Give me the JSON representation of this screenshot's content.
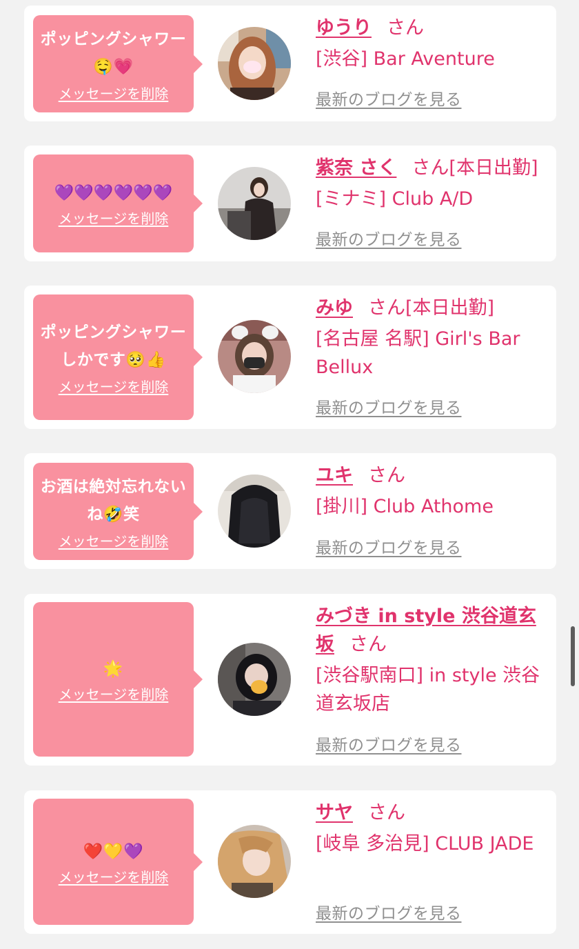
{
  "colors": {
    "background": "#f2f2f2",
    "bubble": "#f9919f",
    "accent": "#e0336c",
    "link_gray": "#8f8f8f"
  },
  "messages": [
    {
      "text": "ポッピングシャワー🤤💗",
      "delete_label": "メッセージを削除",
      "avatar_icon": "profile-photo-woman-1",
      "name": "ゆうり",
      "honorific": "さん",
      "status": "",
      "shop": "[渋谷] Bar Aventure",
      "blog_label": "最新のブログを見る"
    },
    {
      "text": "💜💜💜💜💜💜",
      "delete_label": "メッセージを削除",
      "avatar_icon": "profile-photo-woman-2",
      "name": "紫奈 さく",
      "honorific": "さん",
      "status": "[本日出勤]",
      "shop": "[ミナミ] Club A/D",
      "blog_label": "最新のブログを見る"
    },
    {
      "text": "ポッピングシャワーしかです🥺👍",
      "delete_label": "メッセージを削除",
      "avatar_icon": "profile-photo-woman-3",
      "name": "みゆ",
      "honorific": "さん",
      "status": "[本日出勤]",
      "shop": "[名古屋 名駅] Girl's Bar Bellux",
      "blog_label": "最新のブログを見る"
    },
    {
      "text": "お酒は絶対忘れないね🤣笑",
      "delete_label": "メッセージを削除",
      "avatar_icon": "profile-photo-woman-4",
      "name": "ユキ",
      "honorific": "さん",
      "status": "",
      "shop": "[掛川] Club Athome",
      "blog_label": "最新のブログを見る"
    },
    {
      "text": "🌟",
      "delete_label": "メッセージを削除",
      "avatar_icon": "profile-photo-woman-5",
      "name": "みづき in style 渋谷道玄坂",
      "honorific": "さん",
      "status": "",
      "shop": "[渋谷駅南口] in style 渋谷道玄坂店",
      "blog_label": "最新のブログを見る"
    },
    {
      "text": "❤️💛💜",
      "delete_label": "メッセージを削除",
      "avatar_icon": "profile-photo-woman-6",
      "name": "サヤ",
      "honorific": "さん",
      "status": "",
      "shop": "[岐阜 多治見] CLUB JADE",
      "blog_label": "最新のブログを見る"
    }
  ]
}
